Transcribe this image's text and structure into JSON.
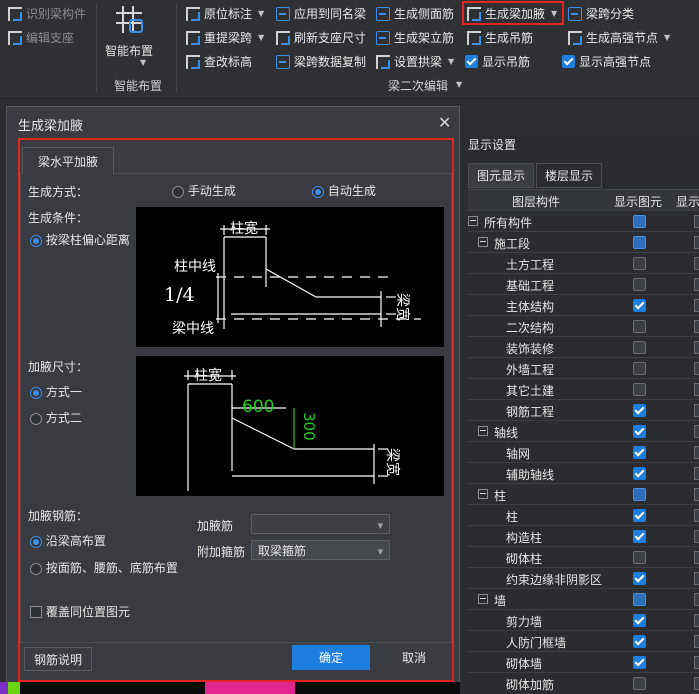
{
  "ribbon": {
    "left_items": [
      "识别梁构件",
      "编辑支座"
    ],
    "smart_layout_button": "智能布置",
    "smart_layout_group": "智能布置",
    "col1": [
      "原位标注",
      "重提梁跨",
      "查改标高"
    ],
    "col2": [
      "应用到同名梁",
      "刷新支座尺寸",
      "梁跨数据复制"
    ],
    "col3": [
      "生成侧面筋",
      "生成架立筋",
      "设置拱梁"
    ],
    "col4": [
      "生成梁加腋",
      "生成吊筋",
      "显示吊筋"
    ],
    "col5": [
      "梁跨分类",
      "生成高强节点",
      "显示高强节点"
    ],
    "group_label": "梁二次编辑"
  },
  "right_panel": {
    "title": "显示设置",
    "tabs": [
      "图元显示",
      "楼层显示"
    ],
    "col_headers": [
      "图层构件",
      "显示图元",
      "显示"
    ],
    "rows": [
      {
        "label": "所有构件",
        "level": 0,
        "expander": true,
        "check": "part"
      },
      {
        "label": "施工段",
        "level": 1,
        "expander": true,
        "check": "part"
      },
      {
        "label": "土方工程",
        "level": 2,
        "check": "off"
      },
      {
        "label": "基础工程",
        "level": 2,
        "check": "off"
      },
      {
        "label": "主体结构",
        "level": 2,
        "check": "on"
      },
      {
        "label": "二次结构",
        "level": 2,
        "check": "off"
      },
      {
        "label": "装饰装修",
        "level": 2,
        "check": "off"
      },
      {
        "label": "外墙工程",
        "level": 2,
        "check": "off"
      },
      {
        "label": "其它土建",
        "level": 2,
        "check": "off"
      },
      {
        "label": "钢筋工程",
        "level": 2,
        "check": "on"
      },
      {
        "label": "轴线",
        "level": 1,
        "expander": true,
        "check": "on"
      },
      {
        "label": "轴网",
        "level": 2,
        "check": "on"
      },
      {
        "label": "辅助轴线",
        "level": 2,
        "check": "on"
      },
      {
        "label": "柱",
        "level": 1,
        "expander": true,
        "check": "part"
      },
      {
        "label": "柱",
        "level": 2,
        "check": "on"
      },
      {
        "label": "构造柱",
        "level": 2,
        "check": "on"
      },
      {
        "label": "砌体柱",
        "level": 2,
        "check": "off"
      },
      {
        "label": "约束边缘非阴影区",
        "level": 2,
        "check": "on"
      },
      {
        "label": "墙",
        "level": 1,
        "expander": true,
        "check": "part"
      },
      {
        "label": "剪力墙",
        "level": 2,
        "check": "on"
      },
      {
        "label": "人防门框墙",
        "level": 2,
        "check": "on"
      },
      {
        "label": "砌体墙",
        "level": 2,
        "check": "on"
      },
      {
        "label": "砌体加筋",
        "level": 2,
        "check": "off"
      }
    ]
  },
  "dialog": {
    "title": "生成梁加腋",
    "tab": "梁水平加腋",
    "gen_mode_label": "生成方式：",
    "manual": "手动生成",
    "auto": "自动生成",
    "gen_condition_label": "生成条件：",
    "condition_option": "按梁柱偏心距离",
    "diagram1": {
      "col_width": "柱宽",
      "col_center": "柱中线",
      "ratio": "1/4",
      "beam_center": "梁中线",
      "beam_width": "梁宽"
    },
    "size_label": "加腋尺寸：",
    "mode1": "方式一",
    "mode2": "方式二",
    "diagram2": {
      "col_width": "柱宽",
      "dim_600": "600",
      "dim_300": "300",
      "beam_width": "梁宽"
    },
    "rebar_label": "加腋钢筋：",
    "rebar_opt1": "沿梁高布置",
    "rebar_opt2": "按面筋、腰筋、底筋布置",
    "haunch_bar_label": "加腋筋",
    "haunch_bar_value": "",
    "stirrup_label": "附加箍筋",
    "stirrup_value": "取梁箍筋",
    "cover_label": "覆盖同位置图元",
    "help_button": "钢筋说明",
    "ok_button": "确定",
    "cancel_button": "取消"
  },
  "colors": {
    "accent": "#1e7fe0",
    "highlight": "#e02525",
    "dim_green": "#22cc22"
  }
}
